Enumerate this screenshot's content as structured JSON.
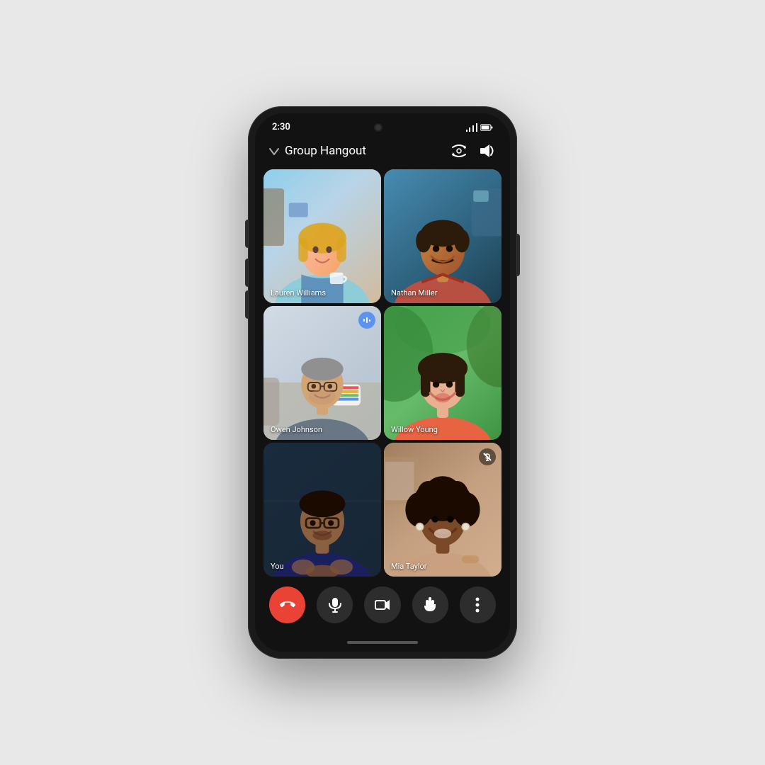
{
  "phone": {
    "status": {
      "time": "2:30",
      "battery_icon": "▮▮▮",
      "signal_icon": "▲"
    },
    "header": {
      "chevron": "∨",
      "title": "Group Hangout",
      "flip_camera_icon": "flip-camera",
      "speaker_icon": "speaker"
    },
    "participants": [
      {
        "id": "lauren",
        "name": "Lauren Williams",
        "tile_class": "tile-lauren",
        "has_speaking_icon": false,
        "is_muted": false
      },
      {
        "id": "nathan",
        "name": "Nathan Miller",
        "tile_class": "tile-nathan",
        "has_speaking_icon": false,
        "is_muted": false
      },
      {
        "id": "owen",
        "name": "Owen Johnson",
        "tile_class": "tile-owen",
        "has_speaking_icon": true,
        "is_muted": false
      },
      {
        "id": "willow",
        "name": "Willow Young",
        "tile_class": "tile-willow",
        "has_speaking_icon": false,
        "is_muted": false
      },
      {
        "id": "you",
        "name": "You",
        "tile_class": "tile-you",
        "has_speaking_icon": false,
        "is_muted": false
      },
      {
        "id": "mia",
        "name": "Mia Taylor",
        "tile_class": "tile-mia",
        "has_speaking_icon": false,
        "is_muted": true
      }
    ],
    "controls": [
      {
        "id": "end-call",
        "icon": "✆",
        "type": "end-call",
        "label": "End call"
      },
      {
        "id": "mute",
        "icon": "🎤",
        "type": "dark",
        "label": "Mute"
      },
      {
        "id": "video",
        "icon": "▭",
        "type": "dark",
        "label": "Video"
      },
      {
        "id": "raise-hand",
        "icon": "✋",
        "type": "dark",
        "label": "Raise hand"
      },
      {
        "id": "more",
        "icon": "⋮",
        "type": "dark",
        "label": "More"
      }
    ]
  }
}
